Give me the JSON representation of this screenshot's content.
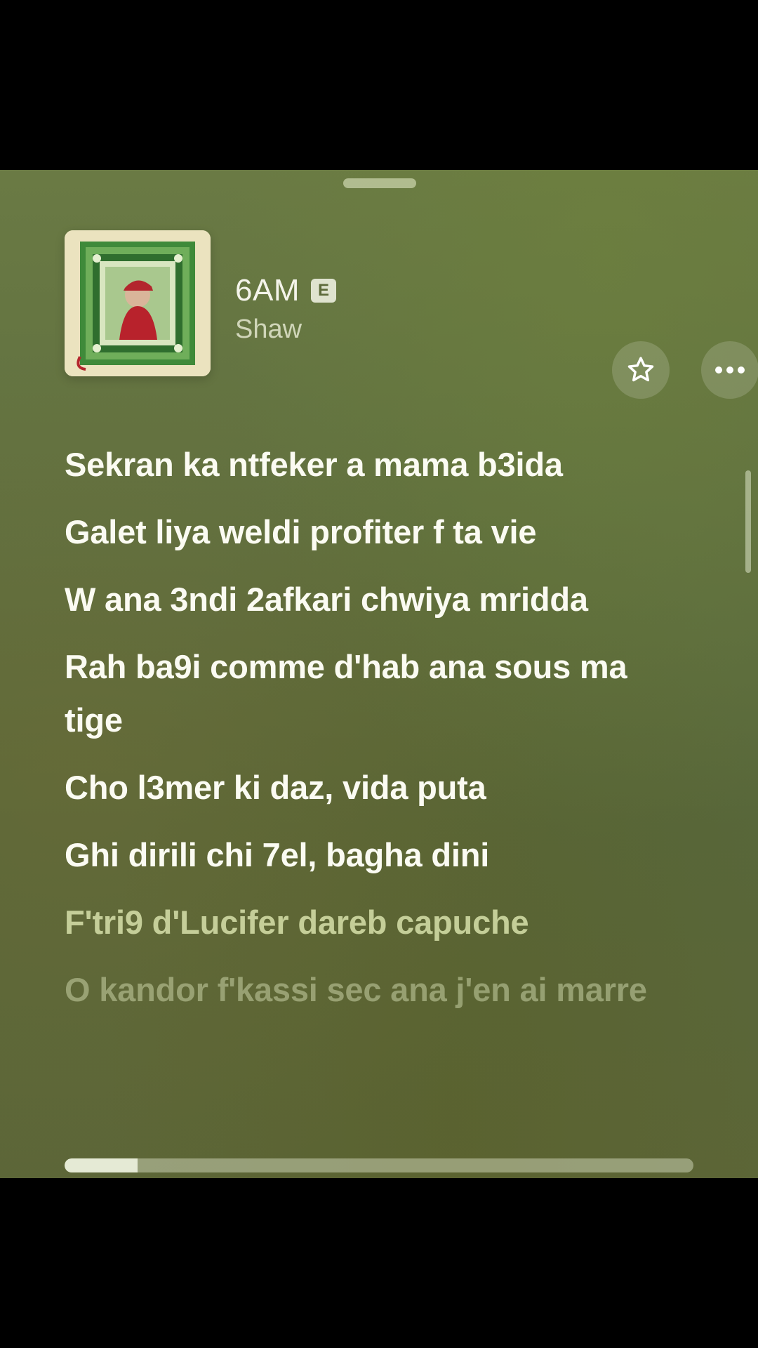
{
  "track": {
    "title": "6AM",
    "explicit_badge": "E",
    "artist": "Shaw"
  },
  "icons": {
    "favorite": "star-icon",
    "more": "ellipsis-icon"
  },
  "lyrics": [
    "Sekran ka ntfeker a mama b3ida",
    "Galet liya weldi profiter f ta vie",
    "W ana 3ndi 2afkari chwiya mridda",
    "Rah ba9i comme d'hab ana sous ma tige",
    "Cho l3mer ki daz, vida puta",
    "Ghi dirili chi 7el, bagha dini",
    "F'tri9 d'Lucifer dareb capuche",
    "O kandor f'kassi sec ana j'en ai marre"
  ],
  "playback": {
    "progress_fraction": 0.116
  },
  "colors": {
    "background": "#607040",
    "active_lyric": "#fbfbf2",
    "explicit_badge_bg": "#dfe3cf"
  }
}
